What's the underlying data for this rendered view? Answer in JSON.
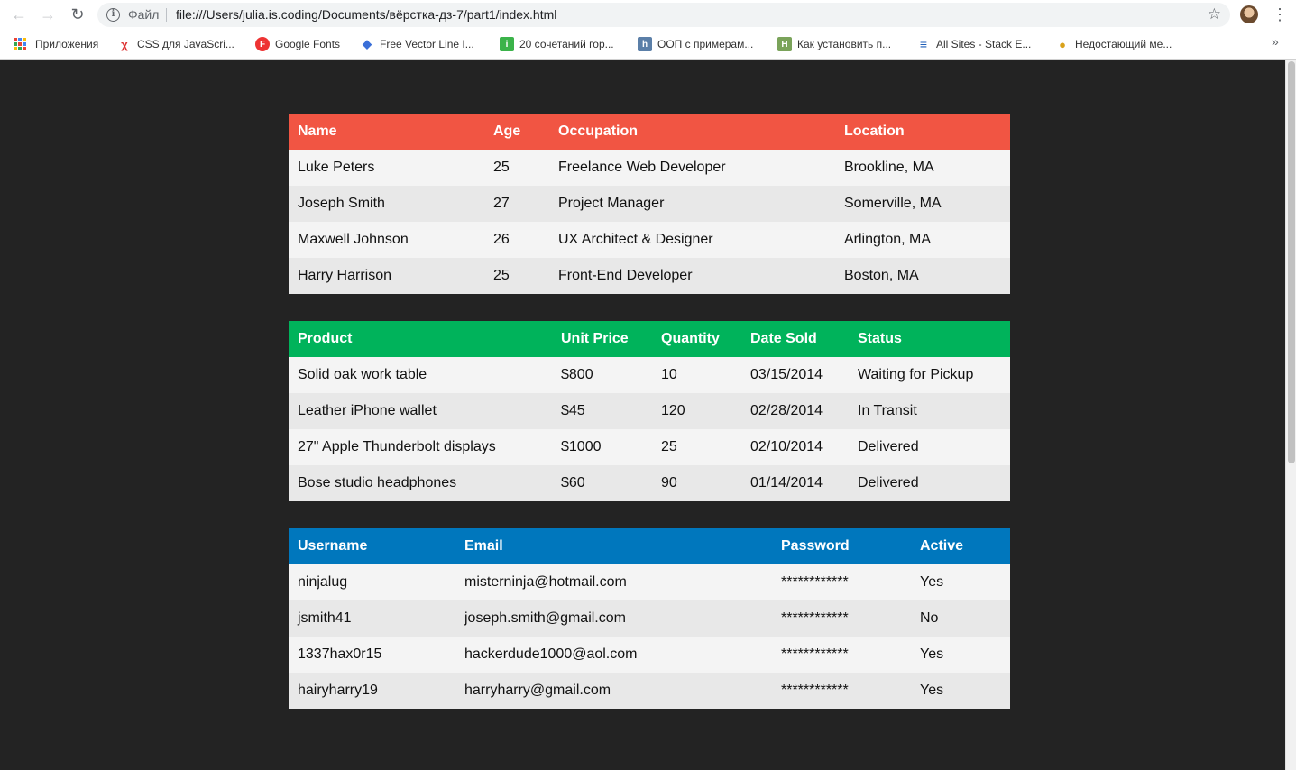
{
  "browser": {
    "scheme_label": "Файл",
    "url": "file:///Users/julia.is.coding/Documents/вёрстка-дз-7/part1/index.html",
    "bookmarks": [
      {
        "label": "Приложения",
        "icon": "apps-grid-icon"
      },
      {
        "label": "CSS для JavaScri...",
        "icon": "red-figure-icon"
      },
      {
        "label": "Google Fonts",
        "icon": "google-fonts-icon"
      },
      {
        "label": "Free Vector Line I...",
        "icon": "diamond-icon"
      },
      {
        "label": "20 сочетаний гор...",
        "icon": "green-figure-icon"
      },
      {
        "label": "ООП с примерам...",
        "icon": "h-icon"
      },
      {
        "label": "Как установить п...",
        "icon": "green-h-icon"
      },
      {
        "label": "All Sites - Stack E...",
        "icon": "stack-exchange-icon"
      },
      {
        "label": "Недостающий ме...",
        "icon": "pear-icon"
      }
    ],
    "overflow_label": "»"
  },
  "tables": {
    "people": {
      "header_color": "#f15543",
      "columns": [
        "Name",
        "Age",
        "Occupation",
        "Location"
      ],
      "rows": [
        [
          "Luke Peters",
          "25",
          "Freelance Web Developer",
          "Brookline, MA"
        ],
        [
          "Joseph Smith",
          "27",
          "Project Manager",
          "Somerville, MA"
        ],
        [
          "Maxwell Johnson",
          "26",
          "UX Architect & Designer",
          "Arlington, MA"
        ],
        [
          "Harry Harrison",
          "25",
          "Front-End Developer",
          "Boston, MA"
        ]
      ]
    },
    "products": {
      "header_color": "#00b35b",
      "columns": [
        "Product",
        "Unit Price",
        "Quantity",
        "Date Sold",
        "Status"
      ],
      "rows": [
        [
          "Solid oak work table",
          "$800",
          "10",
          "03/15/2014",
          "Waiting for Pickup"
        ],
        [
          "Leather iPhone wallet",
          "$45",
          "120",
          "02/28/2014",
          "In Transit"
        ],
        [
          "27\" Apple Thunderbolt displays",
          "$1000",
          "25",
          "02/10/2014",
          "Delivered"
        ],
        [
          "Bose studio headphones",
          "$60",
          "90",
          "01/14/2014",
          "Delivered"
        ]
      ]
    },
    "users": {
      "header_color": "#0077bd",
      "columns": [
        "Username",
        "Email",
        "Password",
        "Active"
      ],
      "rows": [
        [
          "ninjalug",
          "misterninja@hotmail.com",
          "************",
          "Yes"
        ],
        [
          "jsmith41",
          "joseph.smith@gmail.com",
          "************",
          "No"
        ],
        [
          "1337hax0r15",
          "hackerdude1000@aol.com",
          "************",
          "Yes"
        ],
        [
          "hairyharry19",
          "harryharry@gmail.com",
          "************",
          "Yes"
        ]
      ]
    }
  }
}
